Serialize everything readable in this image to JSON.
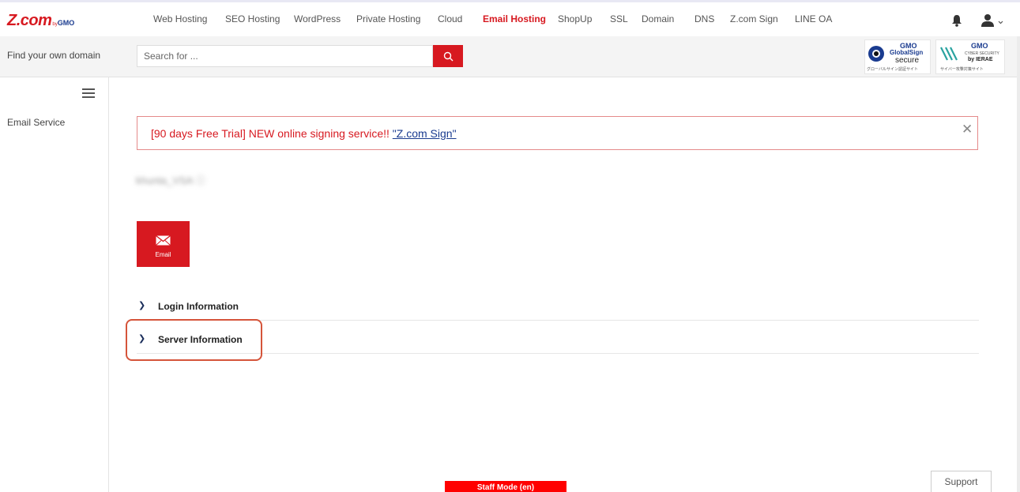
{
  "brand": {
    "logo_main": "Z.com",
    "logo_by": "by",
    "logo_gmo": "GMO"
  },
  "nav": {
    "items": [
      {
        "label": "Web Hosting",
        "active": false
      },
      {
        "label": "SEO Hosting",
        "active": false
      },
      {
        "label": "WordPress",
        "active": false
      },
      {
        "label": "Private Hosting",
        "active": false
      },
      {
        "label": "Cloud",
        "active": false
      },
      {
        "label": "Email Hosting",
        "active": true
      },
      {
        "label": "ShopUp",
        "active": false
      },
      {
        "label": "SSL",
        "active": false
      },
      {
        "label": "Domain",
        "active": false
      },
      {
        "label": "DNS",
        "active": false
      },
      {
        "label": "Z.com Sign",
        "active": false
      },
      {
        "label": "LINE OA",
        "active": false
      }
    ],
    "icons": [
      "bell-icon",
      "user-icon",
      "chevron-down-icon"
    ]
  },
  "search": {
    "label": "Find your own domain",
    "placeholder": "Search for ...",
    "button_icon": "search-icon"
  },
  "badges": {
    "globalsign": {
      "line1": "GMO",
      "line2": "GlobalSign",
      "line3": "secure",
      "caption": "グローバルサイン認証サイト"
    },
    "cyber": {
      "line1": "GMO",
      "line2": "CYBER SECURITY",
      "line3": "by IERAE",
      "caption": "サイバー攻撃対策サイト"
    }
  },
  "sidebar": {
    "menu_icon": "hamburger-icon",
    "items": [
      {
        "label": "Email Service"
      }
    ]
  },
  "alert": {
    "text": "[90 days Free Trial] NEW online signing service!! ",
    "link": "\"Z.com Sign\"",
    "close": "✕"
  },
  "account": {
    "name": "khunta_VSA ⓘ"
  },
  "tiles": [
    {
      "label": "Email",
      "icon": "envelope-icon"
    }
  ],
  "sections": [
    {
      "label": "Login Information",
      "chevron": "❯"
    },
    {
      "label": "Server Information",
      "chevron": "❯"
    }
  ],
  "footer": {
    "staff_mode": "Staff Mode (en)",
    "support": "Support"
  },
  "colors": {
    "brand_red": "#d71920",
    "navy": "#1a3b8f",
    "highlight": "#d5543a"
  }
}
